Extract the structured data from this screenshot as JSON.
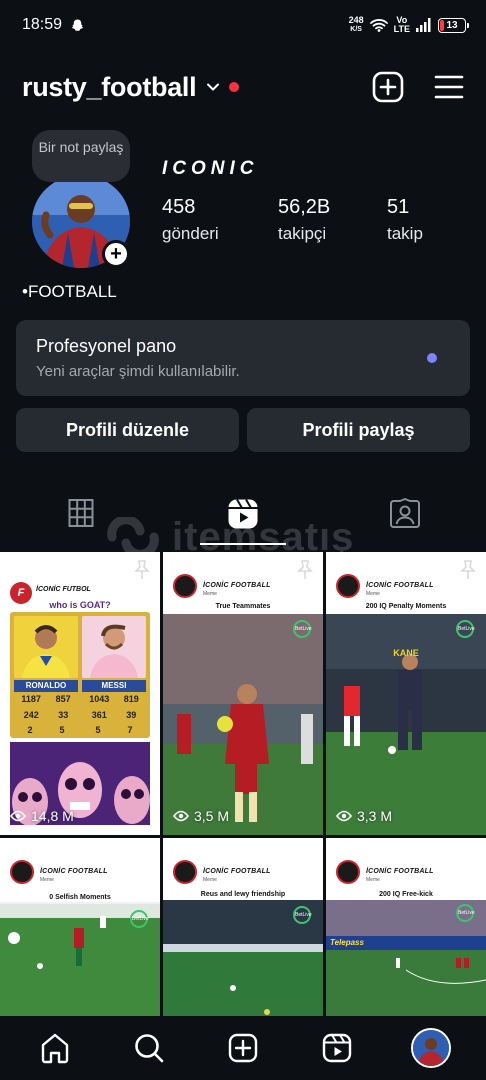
{
  "status_bar": {
    "time": "18:59",
    "net_speed_value": "248",
    "net_speed_unit": "K/S",
    "volte_top": "Vo",
    "volte_bottom": "LTE",
    "battery": "13"
  },
  "header": {
    "username": "rusty_football"
  },
  "profile": {
    "note_text": "Bir not paylaş",
    "display_name": "ICONIC",
    "bio": "•FOOTBALL",
    "stats": [
      {
        "value": "458",
        "label": "gönderi"
      },
      {
        "value": "56,2B",
        "label": "takipçi"
      },
      {
        "value": "51",
        "label": "takip"
      }
    ]
  },
  "dashboard": {
    "title": "Profesyonel pano",
    "subtitle": "Yeni araçlar şimdi kullanılabilir."
  },
  "buttons": {
    "edit": "Profili düzenle",
    "share": "Profili paylaş"
  },
  "watermark": "itemsatış",
  "reels": [
    {
      "views": "14,8 M",
      "brand": "İCONİC FUTBOL",
      "caption": "who is GOAT?",
      "players": [
        {
          "name": "RONALDO",
          "row1": [
            "1187",
            "857"
          ],
          "row2": [
            "242",
            "33"
          ],
          "row3": [
            "2",
            "5"
          ]
        },
        {
          "name": "MESSI",
          "row1": [
            "1043",
            "819"
          ],
          "row2": [
            "361",
            "39"
          ],
          "row3": [
            "5",
            "7"
          ]
        }
      ]
    },
    {
      "views": "3,5 M",
      "brand": "İCONİC FOOTBALL",
      "sub": "Meme",
      "caption": "True Teammates",
      "badge": "BetLive"
    },
    {
      "views": "3,3 M",
      "brand": "İCONİC FOOTBALL",
      "sub": "Meme",
      "caption": "200 IQ Penalty Moments",
      "label": "KANE",
      "badge": "BetLive"
    },
    {
      "views": "",
      "brand": "İCONİC FOOTBALL",
      "sub": "Meme",
      "caption": "0 Selfish Moments",
      "badge": "BetLive"
    },
    {
      "views": "",
      "brand": "İCONİC FOOTBALL",
      "sub": "Meme",
      "caption": "Reus and lewy friendship",
      "badge": "BetLive"
    },
    {
      "views": "",
      "brand": "İCONİC FOOTBALL",
      "sub": "Meme",
      "caption": "200 IQ Free-kick",
      "badge": "BetLive",
      "ad": "Telepass"
    }
  ]
}
